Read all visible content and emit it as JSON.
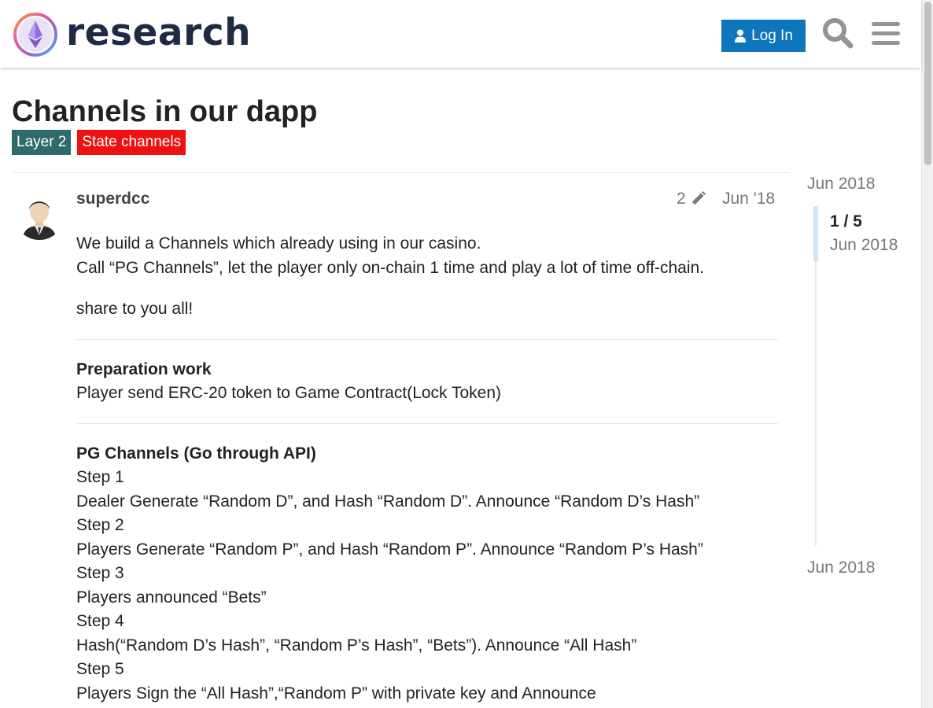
{
  "header": {
    "site_name": "research",
    "login_label": "Log In"
  },
  "topic": {
    "title": "Channels in our dapp",
    "tags": [
      "Layer 2",
      "State channels"
    ]
  },
  "post": {
    "username": "superdcc",
    "edit_count": "2",
    "date": "Jun '18",
    "body": {
      "intro_line1": "We build a Channels which already using in our casino.",
      "intro_line2": "Call “PG Channels”, let the player only on-chain 1 time and play a lot of time off-chain.",
      "share": "share to you all!",
      "prep_heading": "Preparation work",
      "prep_text": "Player send ERC-20 token to Game Contract(Lock Token)",
      "pg_heading": "PG Channels (Go through API)",
      "step1": "Step 1",
      "step1_text": "Dealer Generate “Random D”, and Hash “Random D”. Announce “Random D’s Hash”",
      "step2": "Step 2",
      "step2_text": "Players Generate “Random P”, and Hash “Random P”. Announce “Random P’s Hash”",
      "step3": "Step 3",
      "step3_text": "Players announced “Bets”",
      "step4": "Step 4",
      "step4_text": "Hash(“Random D’s Hash”, “Random P’s Hash”, “Bets”). Announce “All Hash”",
      "step5": "Step 5",
      "step5_text": "Players Sign the “All Hash”,“Random P” with private key and Announce"
    }
  },
  "timeline": {
    "start_date": "Jun 2018",
    "position": "1 / 5",
    "position_date": "Jun 2018",
    "end_date": "Jun 2018"
  },
  "colors": {
    "brand_blue": "#0e76bd",
    "tag_layer2": "#2e6b6b",
    "tag_state_channels": "#ee1111"
  }
}
